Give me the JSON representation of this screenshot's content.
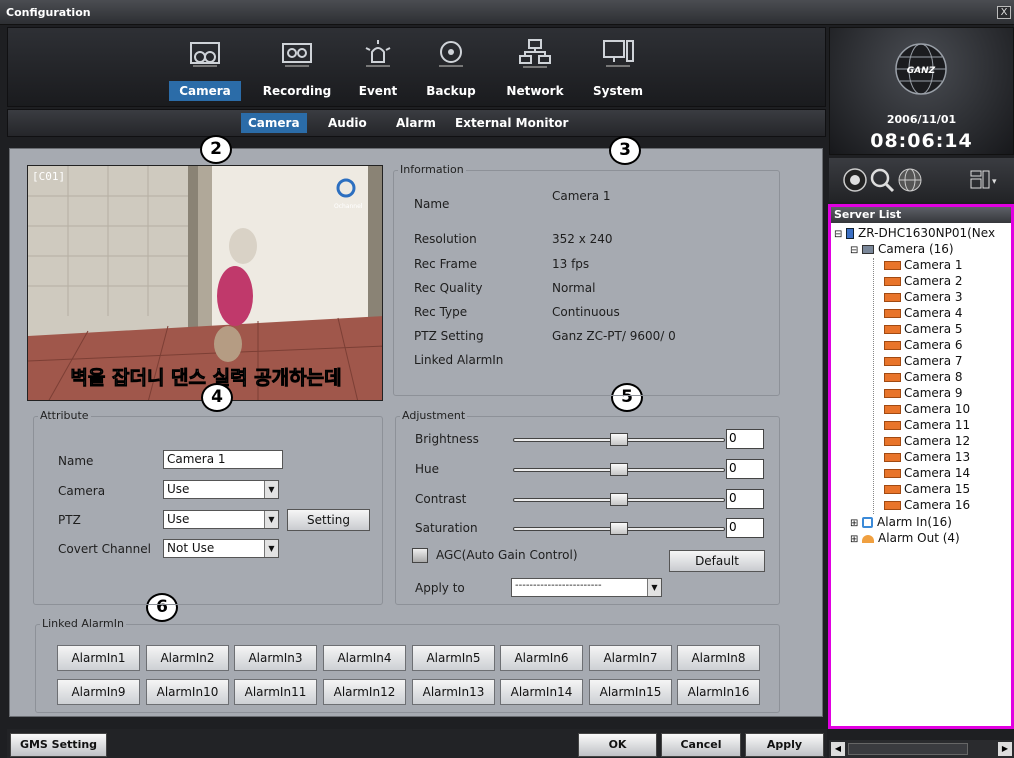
{
  "window": {
    "title": "Configuration",
    "close_glyph": "X"
  },
  "nav": {
    "items": [
      {
        "label": "Camera",
        "icon": "camera-icon",
        "active": true
      },
      {
        "label": "Recording",
        "icon": "recording-icon"
      },
      {
        "label": "Event",
        "icon": "event-icon"
      },
      {
        "label": "Backup",
        "icon": "backup-icon"
      },
      {
        "label": "Network",
        "icon": "network-icon"
      },
      {
        "label": "System",
        "icon": "system-icon"
      }
    ]
  },
  "subtabs": [
    {
      "label": "Camera",
      "active": true
    },
    {
      "label": "Audio"
    },
    {
      "label": "Alarm"
    },
    {
      "label": "External Monitor"
    }
  ],
  "callouts": [
    "2",
    "3",
    "4",
    "5",
    "6"
  ],
  "video": {
    "channel_label": "[C01]",
    "caption": "벽을 잡더니 댄스 실력 공개하는데",
    "logo_text": "Ochannel"
  },
  "information": {
    "legend": "Information",
    "rows": [
      {
        "label": "Name",
        "value": "Camera 1"
      },
      {
        "label": "Resolution",
        "value": "352 x 240"
      },
      {
        "label": "Rec Frame",
        "value": "13 fps"
      },
      {
        "label": "Rec Quality",
        "value": "Normal"
      },
      {
        "label": "Rec Type",
        "value": "Continuous"
      },
      {
        "label": "PTZ Setting",
        "value": "Ganz ZC-PT/ 9600/ 0"
      },
      {
        "label": "Linked AlarmIn",
        "value": ""
      }
    ]
  },
  "attribute": {
    "legend": "Attribute",
    "name_label": "Name",
    "name_value": "Camera 1",
    "camera_label": "Camera",
    "camera_value": "Use",
    "ptz_label": "PTZ",
    "ptz_value": "Use",
    "setting_button": "Setting",
    "covert_label": "Covert Channel",
    "covert_value": "Not Use"
  },
  "adjustment": {
    "legend": "Adjustment",
    "sliders": [
      {
        "label": "Brightness",
        "value": "0",
        "level": 0.5
      },
      {
        "label": "Hue",
        "value": "0",
        "level": 0.5
      },
      {
        "label": "Contrast",
        "value": "0",
        "level": 0.5
      },
      {
        "label": "Saturation",
        "value": "0",
        "level": 0.5
      }
    ],
    "agc_label": "AGC(Auto Gain Control)",
    "default_button": "Default",
    "apply_to_label": "Apply to",
    "apply_to_value": "------------------------"
  },
  "linked_alarmin": {
    "legend": "Linked AlarmIn",
    "buttons": [
      "AlarmIn1",
      "AlarmIn2",
      "AlarmIn3",
      "AlarmIn4",
      "AlarmIn5",
      "AlarmIn6",
      "AlarmIn7",
      "AlarmIn8",
      "AlarmIn9",
      "AlarmIn10",
      "AlarmIn11",
      "AlarmIn12",
      "AlarmIn13",
      "AlarmIn14",
      "AlarmIn15",
      "AlarmIn16"
    ]
  },
  "footer": {
    "gms_setting": "GMS Setting",
    "ok": "OK",
    "cancel": "Cancel",
    "apply": "Apply"
  },
  "status": {
    "brand": "GANZ",
    "date": "2006/11/01",
    "time": "08:06:14"
  },
  "server_list": {
    "header": "Server List",
    "server": "ZR-DHC1630NP01(Nex",
    "camera_group": "Camera (16)",
    "cameras": [
      "Camera 1",
      "Camera 2",
      "Camera 3",
      "Camera 4",
      "Camera 5",
      "Camera 6",
      "Camera 7",
      "Camera 8",
      "Camera 9",
      "Camera 10",
      "Camera 11",
      "Camera 12",
      "Camera 13",
      "Camera 14",
      "Camera 15",
      "Camera 16"
    ],
    "alarm_in": "Alarm In(16)",
    "alarm_out": "Alarm Out (4)"
  },
  "colors": {
    "accent": "#2b6ca8",
    "panel": "#a6aab1",
    "highlight_border": "#e100e1"
  }
}
